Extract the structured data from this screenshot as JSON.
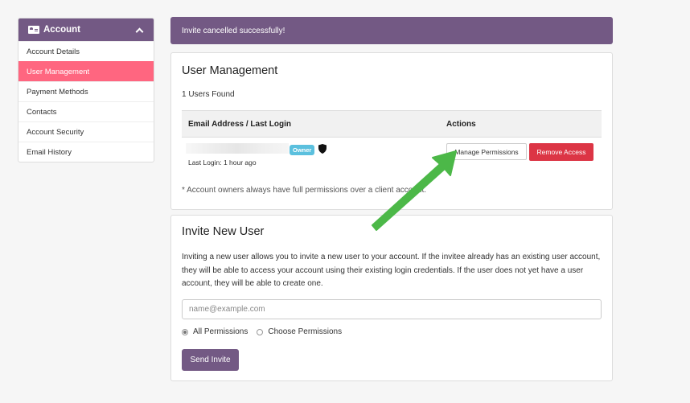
{
  "sidebar": {
    "header": {
      "title": "Account",
      "icon": "id-card-icon",
      "toggle_icon": "chevron-up-icon"
    },
    "items": [
      {
        "label": "Account Details",
        "active": false
      },
      {
        "label": "User Management",
        "active": true
      },
      {
        "label": "Payment Methods",
        "active": false
      },
      {
        "label": "Contacts",
        "active": false
      },
      {
        "label": "Account Security",
        "active": false
      },
      {
        "label": "Email History",
        "active": false
      }
    ]
  },
  "alert": {
    "message": "Invite cancelled successfully!"
  },
  "user_management": {
    "title": "User Management",
    "count_text": "1 Users Found",
    "columns": [
      "Email Address / Last Login",
      "Actions"
    ],
    "rows": [
      {
        "email": "",
        "badge": "Owner",
        "icon": "shield-icon",
        "last_login": "Last Login: 1 hour ago",
        "actions": [
          "Manage Permissions",
          "Remove Access"
        ]
      }
    ],
    "note": "* Account owners always have full permissions over a client account."
  },
  "invite": {
    "title": "Invite New User",
    "description": "Inviting a new user allows you to invite a new user to your account. If the invitee already has an existing user account, they will be able to access your account using their existing login credentials. If the user does not yet have a user account, they will be able to create one.",
    "email_placeholder": "name@example.com",
    "email_value": "",
    "permission_options": [
      {
        "label": "All Permissions",
        "checked": true
      },
      {
        "label": "Choose Permissions",
        "checked": false
      }
    ],
    "submit_label": "Send Invite"
  },
  "colors": {
    "brand": "#735984",
    "active_item": "#ff6680",
    "danger": "#dc3545",
    "badge": "#5bc0de",
    "annotation_arrow": "#4cb848"
  }
}
